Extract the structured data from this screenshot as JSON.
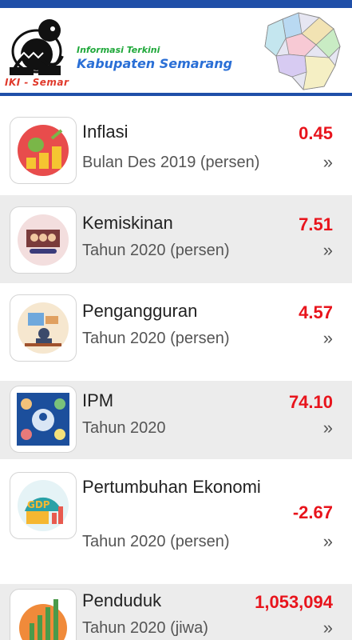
{
  "header": {
    "logo_caption": "IKI - Semar",
    "subtitle": "Informasi Terkini",
    "title": "Kabupaten Semarang"
  },
  "colors": {
    "accent_blue": "#1f4fa8",
    "value_red": "#e8141c",
    "subtitle_green": "#1fa83a",
    "title_blue": "#2a6fd6",
    "alt_row_bg": "#ececec"
  },
  "indicators": [
    {
      "name": "Inflasi",
      "value": "0.45",
      "period": "Bulan Des 2019 (persen)",
      "icon": "money-growth-icon",
      "action": "»"
    },
    {
      "name": "Kemiskinan",
      "value": "7.51",
      "period": "Tahun 2020 (persen)",
      "icon": "poverty-icon",
      "action": "»"
    },
    {
      "name": "Pengangguran",
      "value": "4.57",
      "period": "Tahun 2020 (persen)",
      "icon": "unemployment-icon",
      "action": "»"
    },
    {
      "name": "IPM",
      "value": "74.10",
      "period": "Tahun 2020",
      "icon": "human-development-icon",
      "action": "»"
    },
    {
      "name": "Pertumbuhan Ekonomi",
      "value": "-2.67",
      "period": "Tahun 2020 (persen)",
      "icon": "gdp-icon",
      "action": "»"
    },
    {
      "name": "Penduduk",
      "value": "1,053,094",
      "period": "Tahun 2020 (jiwa)",
      "icon": "population-chart-icon",
      "action": "»"
    }
  ]
}
